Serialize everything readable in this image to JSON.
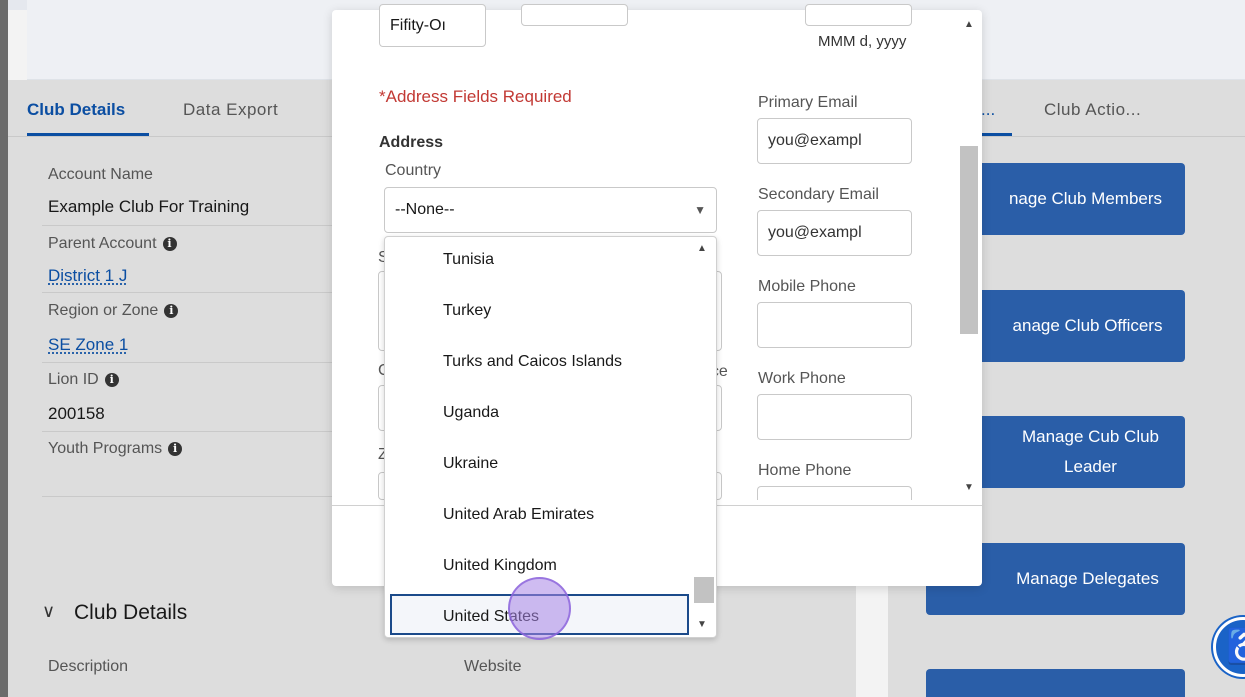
{
  "tabs": {
    "active": "Club Details",
    "second": "Data Export",
    "right_1": "...",
    "right_2": "Club Actio..."
  },
  "details": {
    "account_name_label": "Account Name",
    "account_name_value": "Example Club For Training",
    "parent_account_label": "Parent Account",
    "parent_account_value": "District 1 J",
    "region_label": "Region or Zone",
    "region_value": "SE Zone 1",
    "lion_id_label": "Lion ID",
    "lion_id_value": "200158",
    "youth_label": "Youth Programs",
    "info_glyph": "i",
    "section_title": "Club Details",
    "description_label": "Description",
    "website_label": "Website"
  },
  "side_buttons": [
    "nage Club Members",
    "anage Club Officers",
    "Manage Cub Club",
    "Leader",
    "Manage Delegates"
  ],
  "modal": {
    "name_value": "Fifity-Oı",
    "date_hint": "MMM d, yyyy",
    "address_required": "*Address Fields Required",
    "address_label": "Address",
    "country_label": "Country",
    "country_value": "--None--",
    "partial_s": "S",
    "partial_c": "C",
    "partial_z": "Z",
    "partial_colon": ":",
    "partial_nce": "nce",
    "primary_email_label": "Primary Email",
    "primary_email_placeholder": "you@exampl",
    "secondary_email_label": "Secondary Email",
    "secondary_email_placeholder": "you@exampl",
    "mobile_phone_label": "Mobile Phone",
    "work_phone_label": "Work Phone",
    "home_phone_label": "Home Phone"
  },
  "country_options": [
    "Tunisia",
    "Turkey",
    "Turks and Caicos Islands",
    "Uganda",
    "Ukraine",
    "United Arab Emirates",
    "United Kingdom",
    "United States"
  ],
  "icons": {
    "chevron": "chevron-down-icon",
    "info": "info-icon",
    "accessibility": "accessibility-icon",
    "scroll_up": "▲",
    "scroll_down": "▼",
    "select_arrow": "▼",
    "section_chevron": "∨",
    "a11y_glyph": "♿"
  },
  "colors": {
    "brand_blue": "#2a5ea8",
    "tab_active": "#0b4ea2",
    "required_red": "#c23934",
    "cursor": "#a785e6"
  }
}
